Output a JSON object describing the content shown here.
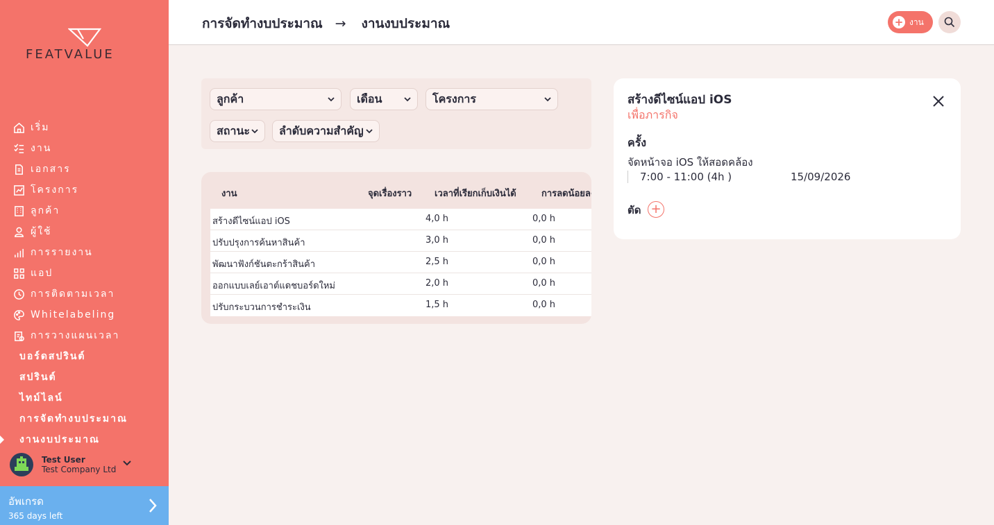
{
  "brand": {
    "name": "FEATVALUE"
  },
  "colors": {
    "accent": "#f4736a",
    "upgrade": "#6ab0ee",
    "background": "#f8f1ef"
  },
  "sidebar": {
    "items": [
      {
        "label": "เริ่ม",
        "icon": "home-icon"
      },
      {
        "label": "งาน",
        "icon": "tasks-icon"
      },
      {
        "label": "เอกสาร",
        "icon": "document-icon"
      },
      {
        "label": "โครงการ",
        "icon": "project-icon"
      },
      {
        "label": "ลูกค้า",
        "icon": "building-icon"
      },
      {
        "label": "ผู้ใช้",
        "icon": "user-icon"
      },
      {
        "label": "การรายงาน",
        "icon": "report-icon"
      },
      {
        "label": "แอป",
        "icon": "apps-icon"
      },
      {
        "label": "การติดตามเวลา",
        "icon": "clock-icon"
      },
      {
        "label": "Whitelabeling",
        "icon": "palette-icon"
      },
      {
        "label": "การวางแผนเวลา",
        "icon": "planning-icon"
      }
    ],
    "subitems": [
      {
        "label": "บอร์ดสปรินต์"
      },
      {
        "label": "สปรินต์"
      },
      {
        "label": "ไทม์ไลน์"
      },
      {
        "label": "การจัดทำงบประมาณ"
      },
      {
        "label": "งานงบประมาณ",
        "active": true
      }
    ],
    "user": {
      "name": "Test User",
      "company": "Test Company Ltd"
    },
    "upgrade": {
      "title": "อัพเกรด",
      "subtitle": "365 days left"
    }
  },
  "header": {
    "breadcrumb_parent": "การจัดทำงบประมาณ",
    "breadcrumb_arrow": "→",
    "breadcrumb_current": "งานงบประมาณ",
    "add_label": "งาน"
  },
  "filters": {
    "customer": "ลูกค้า",
    "month": "เดือน",
    "project": "โครงการ",
    "status": "สถานะ",
    "priority": "ลำดับความสำคัญ"
  },
  "table": {
    "headers": [
      "งาน",
      "จุดเรื่องราว",
      "เวลาที่เรียกเก็บเงินได้",
      "การลดน้อยลง"
    ],
    "rows": [
      {
        "task": "สร้างดีไซน์แอป iOS",
        "story": "",
        "billable": "4,0 h",
        "reduced": "0,0 h"
      },
      {
        "task": "ปรับปรุงการค้นหาสินค้า",
        "story": "",
        "billable": "3,0 h",
        "reduced": "0,0 h"
      },
      {
        "task": "พัฒนาฟังก์ชันตะกร้าสินค้า",
        "story": "",
        "billable": "2,5 h",
        "reduced": "0,0 h"
      },
      {
        "task": "ออกแบบเลย์เอาต์แดชบอร์ดใหม่",
        "story": "",
        "billable": "2,0 h",
        "reduced": "0,0 h"
      },
      {
        "task": "ปรับกระบวนการชำระเงิน",
        "story": "",
        "billable": "1,5 h",
        "reduced": "0,0 h"
      }
    ]
  },
  "detail": {
    "title": "สร้างดีไซน์แอป iOS",
    "subtitle": "เพื่อภารกิจ",
    "section": "ครั้ง",
    "description": "จัดหน้าจอ iOS ให้สอดคล้อง",
    "time": "7:00 - 11:00 (4h )",
    "date": "15/09/2026",
    "cut_label": "ตัด"
  }
}
